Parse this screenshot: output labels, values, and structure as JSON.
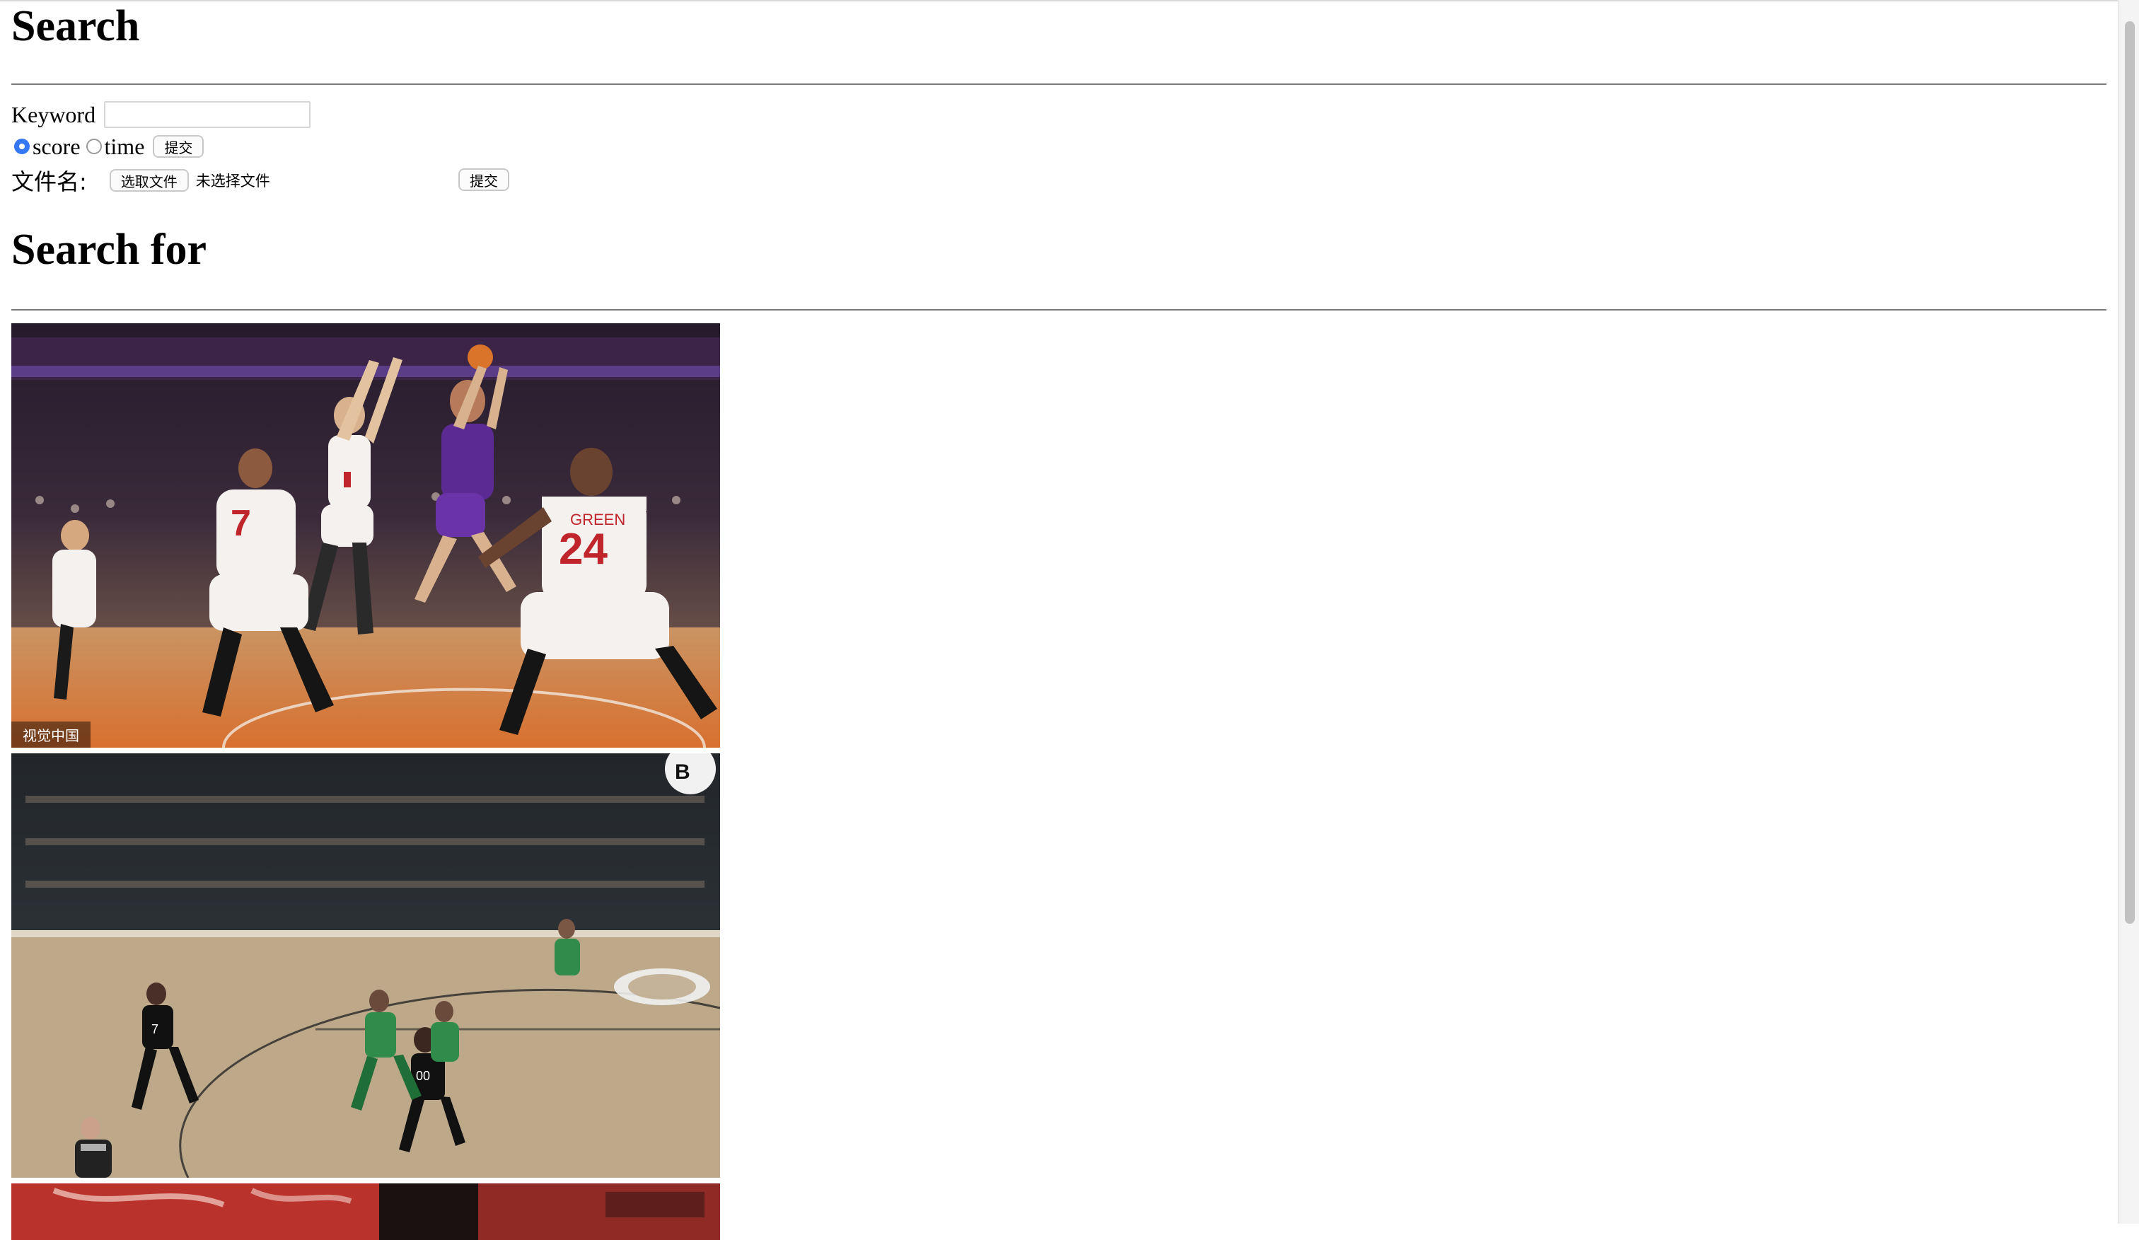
{
  "page": {
    "heading_search": "Search",
    "heading_results": "Search for"
  },
  "keyword_form": {
    "label": "Keyword",
    "input_value": "",
    "sort_options": [
      {
        "label": "score",
        "checked": true
      },
      {
        "label": "time",
        "checked": false
      }
    ],
    "submit_label": "提交"
  },
  "file_form": {
    "label": "文件名:",
    "choose_label": "选取文件",
    "status": "未选择文件",
    "submit_label": "提交"
  },
  "results": [
    {
      "kind": "basketball-photo",
      "watermark": "视觉中国",
      "jersey_number": "24",
      "jersey_name": "GREEN"
    },
    {
      "kind": "basketball-photo",
      "watermark": "",
      "jersey_number": "00",
      "jersey_name": ""
    },
    {
      "kind": "basketball-photo-partial",
      "watermark": ""
    }
  ],
  "colors": {
    "radio_checked": "#3478f6",
    "rule": "#7a7a7a",
    "court": "#c9a57a"
  }
}
